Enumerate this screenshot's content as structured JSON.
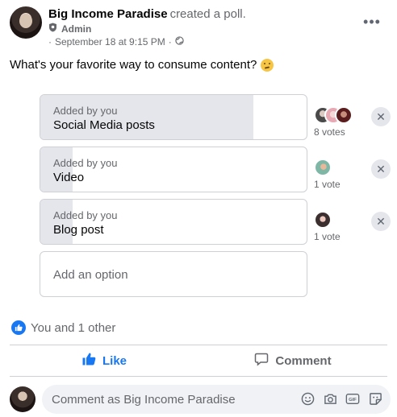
{
  "post": {
    "author": "Big Income Paradise",
    "action": "created a poll.",
    "role": "Admin",
    "timestamp": "September 18 at 9:15 PM",
    "privacy_separator": "·",
    "question": "What's your favorite way to consume content?"
  },
  "poll": {
    "options": [
      {
        "meta": "Added by you",
        "label": "Social Media posts",
        "votes_text": "8 votes",
        "votes": 8,
        "fill_fraction": 0.8
      },
      {
        "meta": "Added by you",
        "label": "Video",
        "votes_text": "1 vote",
        "votes": 1,
        "fill_fraction": 0.12
      },
      {
        "meta": "Added by you",
        "label": "Blog post",
        "votes_text": "1 vote",
        "votes": 1,
        "fill_fraction": 0.12
      }
    ],
    "remove_symbol": "✕",
    "add_option_placeholder": "Add an option"
  },
  "reactions": {
    "summary": "You and 1 other"
  },
  "actions": {
    "like_label": "Like",
    "comment_label": "Comment"
  },
  "composer": {
    "placeholder": "Comment as Big Income Paradise"
  },
  "icons": [
    "more-icon",
    "shield-icon",
    "globe-icon",
    "thinking-face-icon",
    "like-icon",
    "comment-icon",
    "smiley-icon",
    "camera-icon",
    "gif-icon",
    "sticker-icon",
    "remove-icon"
  ],
  "colors": {
    "accent": "#1877f2",
    "secondary_text": "#65676b",
    "fill": "#e4e6eb"
  }
}
